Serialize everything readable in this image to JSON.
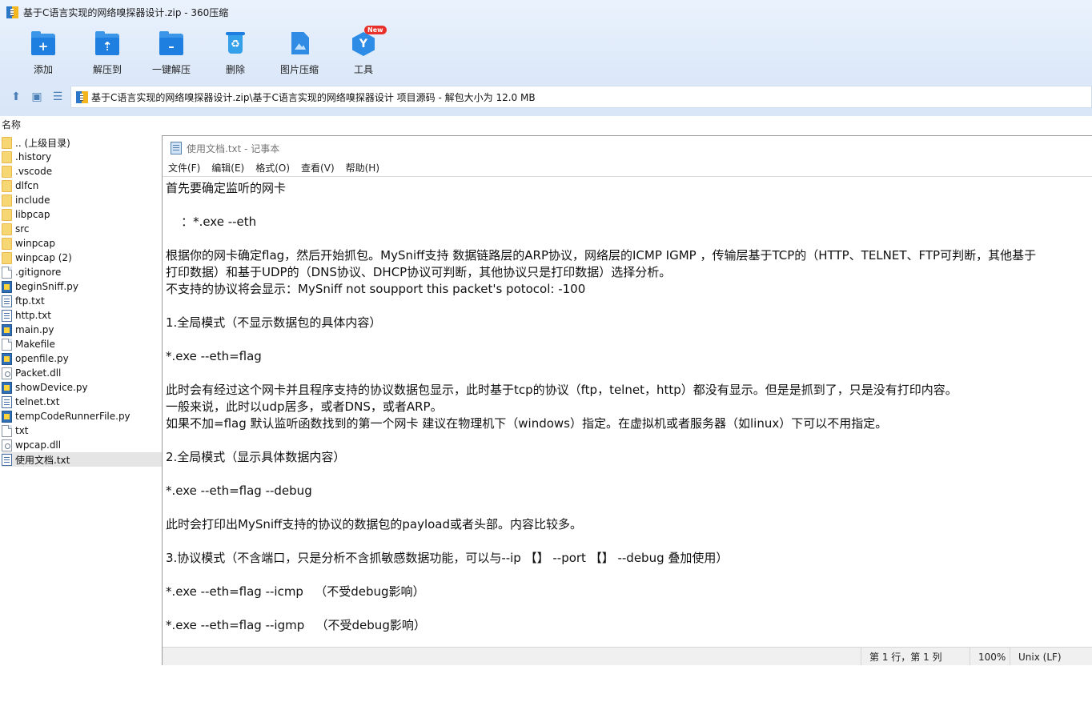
{
  "window": {
    "title": "基于C语言实现的网络嗅探器设计.zip - 360压缩"
  },
  "toolbar": {
    "items": [
      {
        "label": "添加",
        "icon": "add-icon"
      },
      {
        "label": "解压到",
        "icon": "extract-to-icon"
      },
      {
        "label": "一键解压",
        "icon": "one-click-extract-icon"
      },
      {
        "label": "删除",
        "icon": "delete-icon"
      },
      {
        "label": "图片压缩",
        "icon": "image-compress-icon"
      },
      {
        "label": "工具",
        "icon": "tools-icon",
        "badge": "New"
      }
    ]
  },
  "address": {
    "path": "基于C语言实现的网络嗅探器设计.zip\\基于C语言实现的网络嗅探器设计 项目源码 - 解包大小为 12.0 MB"
  },
  "filelist": {
    "column_name": "名称",
    "items": [
      {
        "name": ".. (上级目录)",
        "type": "folder"
      },
      {
        "name": ".history",
        "type": "folder"
      },
      {
        "name": ".vscode",
        "type": "folder"
      },
      {
        "name": "dlfcn",
        "type": "folder"
      },
      {
        "name": "include",
        "type": "folder"
      },
      {
        "name": "libpcap",
        "type": "folder"
      },
      {
        "name": "src",
        "type": "folder"
      },
      {
        "name": "winpcap",
        "type": "folder"
      },
      {
        "name": "winpcap (2)",
        "type": "folder"
      },
      {
        "name": ".gitignore",
        "type": "file"
      },
      {
        "name": "beginSniff.py",
        "type": "py"
      },
      {
        "name": "ftp.txt",
        "type": "txt"
      },
      {
        "name": "http.txt",
        "type": "txt"
      },
      {
        "name": "main.py",
        "type": "py"
      },
      {
        "name": "Makefile",
        "type": "file"
      },
      {
        "name": "openfile.py",
        "type": "py"
      },
      {
        "name": "Packet.dll",
        "type": "dll"
      },
      {
        "name": "showDevice.py",
        "type": "py"
      },
      {
        "name": "telnet.txt",
        "type": "txt"
      },
      {
        "name": "tempCodeRunnerFile.py",
        "type": "py"
      },
      {
        "name": "txt",
        "type": "file"
      },
      {
        "name": "wpcap.dll",
        "type": "dll"
      },
      {
        "name": "使用文档.txt",
        "type": "txt",
        "selected": true
      }
    ]
  },
  "notepad": {
    "title": "使用文档.txt - 记事本",
    "menu": [
      "文件(F)",
      "编辑(E)",
      "格式(O)",
      "查看(V)",
      "帮助(H)"
    ],
    "lines": [
      "首先要确定监听的网卡",
      "",
      "    ：*.exe --eth",
      "",
      "根据你的网卡确定flag，然后开始抓包。MySniff支持 数据链路层的ARP协议，网络层的ICMP IGMP ，传输层基于TCP的（HTTP、TELNET、FTP可判断，其他基于",
      "打印数据）和基于UDP的（DNS协议、DHCP协议可判断，其他协议只是打印数据）选择分析。",
      "不支持的协议将会显示：MySniff not soupport this packet's potocol: -100",
      "",
      "1.全局模式（不显示数据包的具体内容）",
      "",
      "*.exe --eth=flag",
      "",
      "此时会有经过这个网卡并且程序支持的协议数据包显示，此时基于tcp的协议（ftp，telnet，http）都没有显示。但是是抓到了，只是没有打印内容。",
      "一般来说，此时以udp居多，或者DNS，或者ARP。",
      "如果不加=flag 默认监听函数找到的第一个网卡 建议在物理机下（windows）指定。在虚拟机或者服务器（如linux）下可以不用指定。",
      "",
      "2.全局模式（显示具体数据内容）",
      "",
      "*.exe --eth=flag --debug",
      "",
      "此时会打印出MySniff支持的协议的数据包的payload或者头部。内容比较多。",
      "",
      "3.协议模式（不含端口，只是分析不含抓敏感数据功能，可以与--ip 【】 --port 【】 --debug 叠加使用）",
      "",
      "*.exe --eth=flag --icmp   （不受debug影响）",
      "",
      "*.exe --eth=flag --igmp   （不受debug影响）",
      ""
    ],
    "status": {
      "position": "第 1 行，第 1 列",
      "zoom": "100%",
      "line_ending": "Unix (LF)"
    }
  }
}
